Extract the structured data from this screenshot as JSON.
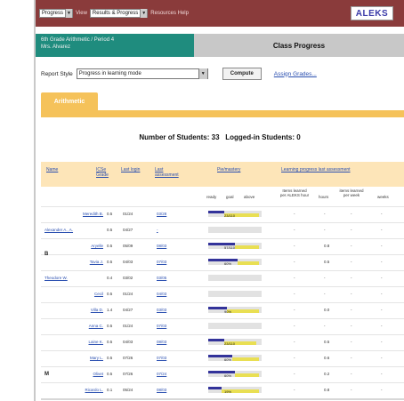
{
  "toolbar": {
    "grades_value": "Progress",
    "view_label": "View",
    "view_value": "Results & Progress",
    "help_text": "Resources Help",
    "logo": "ALEKS"
  },
  "class": {
    "name_line1": "6th Grade Arithmetic / Period 4",
    "name_line2": "Mrs. Alvarez",
    "title": "Class Progress"
  },
  "report": {
    "label": "Report Style",
    "value": "Progress in learning mode",
    "compute": "Compute",
    "assign": "Assign Grades..."
  },
  "tab": {
    "label": "Arithmetic"
  },
  "counts": {
    "students_label": "Number of Students:",
    "students": "33",
    "logged_label": "Logged-in Students:",
    "logged": "0"
  },
  "table": {
    "headers": [
      "Name",
      "ICSe Grade",
      "Last login",
      "Last assessment",
      "Pie/mastery",
      "Learning progress last assessment"
    ],
    "subheaders": [
      "ready",
      "goal",
      "above",
      "Items learned per ALEKS hour",
      "hours",
      "items learned per week",
      "weeks"
    ],
    "rows": [
      {
        "group": "",
        "name": "Meredith B.",
        "grade": "0.5",
        "login": "01/24",
        "last": "03/28",
        "blue": 0.3,
        "yellow": 0.65,
        "label": "23/110",
        "c1": "-",
        "c2": "-",
        "c3": "-",
        "c4": "-"
      },
      {
        "group": "Alexander A., A.",
        "name": "",
        "grade": "0.5",
        "login": "04/27",
        "last": "-",
        "blue": 0,
        "yellow": 0,
        "label": "",
        "c1": "-",
        "c2": "-",
        "c3": "-",
        "c4": "-"
      },
      {
        "group": "",
        "name": "Aryelle",
        "grade": "0.5",
        "login": "05/09",
        "last": "08/03",
        "blue": 0.5,
        "yellow": 0.45,
        "label": "57/110",
        "c1": "-",
        "c2": "0.8",
        "c3": "-",
        "c4": "-"
      },
      {
        "group": "",
        "name": "Tavia J.",
        "grade": "0.5",
        "login": "04/03",
        "last": "07/03",
        "blue": 0.55,
        "yellow": 0.4,
        "label": "60%",
        "c1": "-",
        "c2": "0.5",
        "c3": "-",
        "c4": "-"
      },
      {
        "group": "Theodore W.",
        "name": "",
        "grade": "0.4",
        "login": "03/02",
        "last": "03/05",
        "blue": 0,
        "yellow": 0,
        "label": "",
        "c1": "-",
        "c2": "-",
        "c3": "-",
        "c4": "-"
      },
      {
        "group": "",
        "name": "Cecil",
        "grade": "0.5",
        "login": "01/24",
        "last": "04/03",
        "blue": 0,
        "yellow": 0,
        "label": "",
        "c1": "-",
        "c2": "-",
        "c3": "-",
        "c4": "-"
      },
      {
        "group": "",
        "name": "Villa D.",
        "grade": "1.4",
        "login": "04/27",
        "last": "03/03",
        "blue": 0.35,
        "yellow": 0.6,
        "label": "90%",
        "c1": "-",
        "c2": "0.0",
        "c3": "-",
        "c4": "-"
      },
      {
        "group": "",
        "name": "Anna C.",
        "grade": "0.5",
        "login": "01/24",
        "last": "07/03",
        "blue": 0,
        "yellow": 0,
        "label": "",
        "c1": "-",
        "c2": "-",
        "c3": "-",
        "c4": "-"
      },
      {
        "group": "",
        "name": "Laine K.",
        "grade": "0.5",
        "login": "04/03",
        "last": "08/03",
        "blue": 0.3,
        "yellow": 0.6,
        "label": "23/110",
        "c1": "-",
        "c2": "0.5",
        "c3": "-",
        "c4": "-"
      },
      {
        "group": "",
        "name": "Mary L.",
        "grade": "0.5",
        "login": "07/26",
        "last": "07/03",
        "blue": 0.45,
        "yellow": 0.5,
        "label": "60%",
        "c1": "-",
        "c2": "0.6",
        "c3": "-",
        "c4": "-"
      },
      {
        "group": "",
        "name": "Olivet",
        "grade": "0.5",
        "login": "07/26",
        "last": "07/24",
        "blue": 0.5,
        "yellow": 0.45,
        "label": "60%",
        "c1": "-",
        "c2": "0.2",
        "c3": "-",
        "c4": "-"
      },
      {
        "group": "",
        "name": "Ricardo L.",
        "grade": "0.1",
        "login": "05/24",
        "last": "08/03",
        "blue": 0.25,
        "yellow": 0.7,
        "label": "19%",
        "c1": "-",
        "c2": "0.8",
        "c3": "-",
        "c4": "-"
      }
    ]
  },
  "colors": {
    "toolbar": "#8a3b3b",
    "class_name_bg": "#1f8c7e",
    "tab": "#f5c25a",
    "table_header": "#fde5b8",
    "bar_blue": "#33339a",
    "bar_yellow": "#e9df53"
  }
}
